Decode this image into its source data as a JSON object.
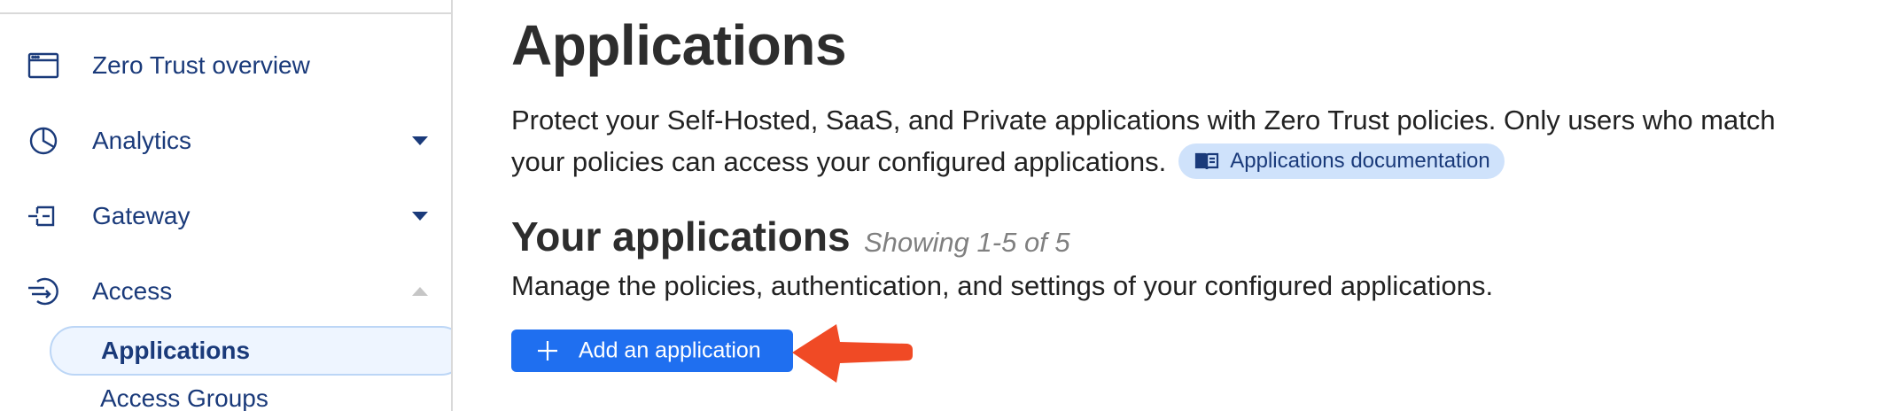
{
  "sidebar": {
    "items": [
      {
        "label": "Zero Trust overview",
        "icon": "browser-window-icon"
      },
      {
        "label": "Analytics",
        "icon": "pie-chart-icon",
        "expanded": false
      },
      {
        "label": "Gateway",
        "icon": "gateway-icon",
        "expanded": false
      },
      {
        "label": "Access",
        "icon": "access-icon",
        "expanded": true
      }
    ],
    "subitems": [
      {
        "label": "Applications",
        "active": true
      },
      {
        "label": "Access Groups",
        "active": false
      }
    ]
  },
  "main": {
    "title": "Applications",
    "description": "Protect your Self-Hosted, SaaS, and Private applications with Zero Trust policies. Only users who match your policies can access your configured applications.",
    "doc_link": {
      "label": "Applications documentation",
      "icon": "book-icon"
    },
    "section": {
      "title": "Your applications",
      "showing": "Showing 1-5 of 5",
      "description": "Manage the policies, authentication, and settings of your configured applications."
    },
    "add_button": {
      "label": "Add an application",
      "icon": "plus-icon"
    }
  },
  "colors": {
    "nav_text": "#1a3a7a",
    "primary_button": "#1f6ff0",
    "doc_chip_bg": "#cfe2fb",
    "active_nav_bg": "#eef5ff",
    "annotation_arrow": "#f04a25"
  }
}
